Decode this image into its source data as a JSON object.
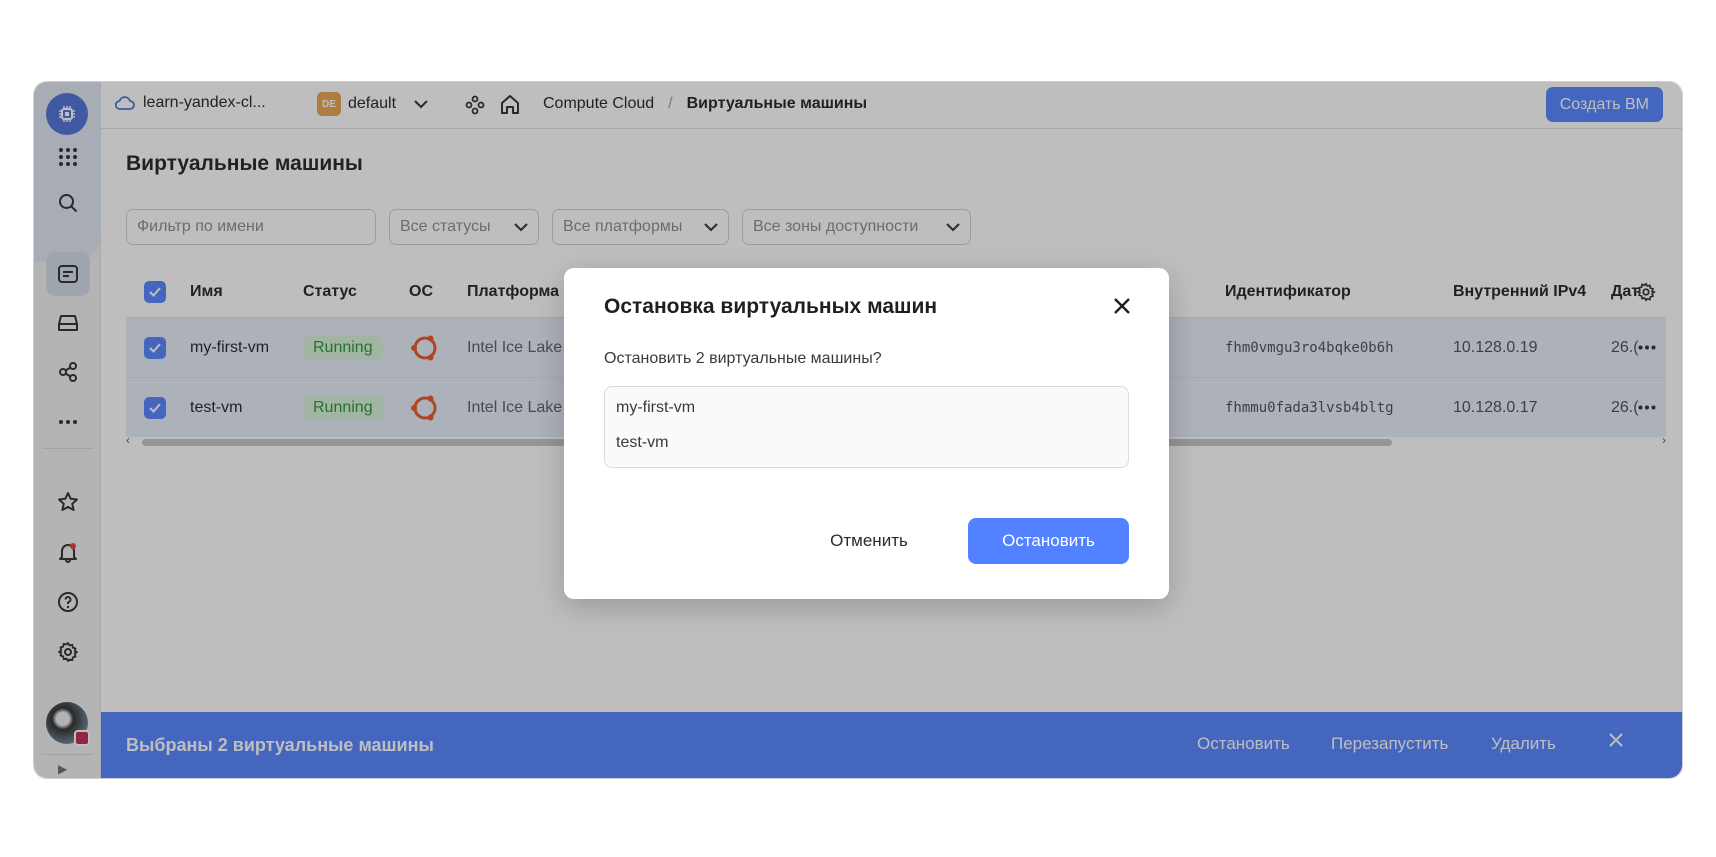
{
  "header": {
    "cloud_name": "learn-yandex-cl...",
    "folder_badge": "DE",
    "folder_name": "default",
    "breadcrumb_service": "Compute Cloud",
    "breadcrumb_separator": "/",
    "breadcrumb_current": "Виртуальные машины",
    "create_button": "Создать ВМ"
  },
  "page": {
    "title": "Виртуальные машины",
    "filter_placeholder": "Фильтр по имени",
    "status_filter": "Все статусы",
    "platform_filter": "Все платформы",
    "zone_filter": "Все зоны доступности"
  },
  "table": {
    "columns": {
      "name": "Имя",
      "status": "Статус",
      "os": "ОС",
      "platform": "Платформа",
      "id": "Идентификатор",
      "ipv4": "Внутренний IPv4",
      "date": "Дат"
    },
    "rows": [
      {
        "name": "my-first-vm",
        "status": "Running",
        "platform": "Intel Ice Lake",
        "id": "fhm0vmgu3ro4bqke0b6h",
        "ipv4": "10.128.0.19",
        "date": "26.("
      },
      {
        "name": "test-vm",
        "status": "Running",
        "platform": "Intel Ice Lake",
        "id": "fhmmu0fada3lvsb4bltg",
        "ipv4": "10.128.0.17",
        "date": "26.("
      }
    ]
  },
  "action_bar": {
    "title": "Выбраны 2 виртуальные машины",
    "stop": "Остановить",
    "restart": "Перезапустить",
    "delete": "Удалить"
  },
  "dialog": {
    "title": "Остановка виртуальных машин",
    "question": "Остановить 2 виртуальные машины?",
    "vms": [
      "my-first-vm",
      "test-vm"
    ],
    "cancel": "Отменить",
    "confirm": "Остановить"
  },
  "colors": {
    "accent": "#5282ff",
    "status_running_bg": "#d7f1d8",
    "status_running_text": "#24922c",
    "ubuntu_orange": "#e95420"
  }
}
